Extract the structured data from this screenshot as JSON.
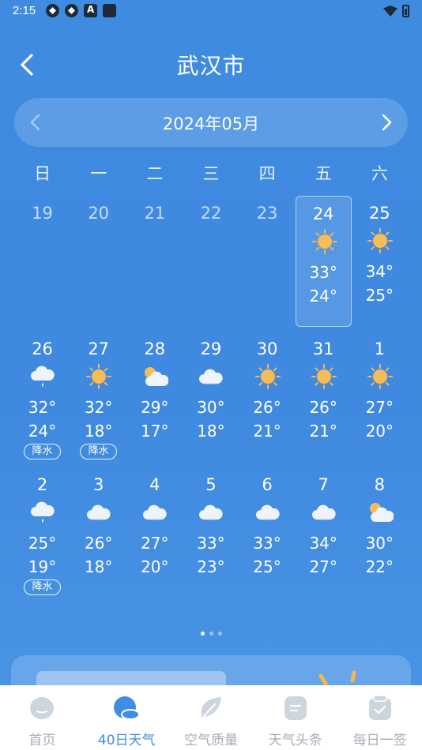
{
  "status_bar": {
    "time": "2:15"
  },
  "header": {
    "title": "武汉市"
  },
  "month_nav": {
    "label": "2024年05月"
  },
  "weekdays": [
    "日",
    "一",
    "二",
    "三",
    "四",
    "五",
    "六"
  ],
  "calendar": {
    "rows": [
      [
        {
          "day": "19",
          "past": true
        },
        {
          "day": "20",
          "past": true
        },
        {
          "day": "21",
          "past": true
        },
        {
          "day": "22",
          "past": true
        },
        {
          "day": "23",
          "past": true
        },
        {
          "day": "24",
          "icon": "sunny-icon",
          "high": "33°",
          "low": "24°",
          "selected": true
        },
        {
          "day": "25",
          "icon": "sunny-icon",
          "high": "34°",
          "low": "25°"
        }
      ],
      [
        {
          "day": "26",
          "icon": "rain-icon",
          "high": "32°",
          "low": "24°",
          "tag": "降水"
        },
        {
          "day": "27",
          "icon": "sunny-icon",
          "high": "32°",
          "low": "18°",
          "tag": "降水"
        },
        {
          "day": "28",
          "icon": "partly-cloudy-icon",
          "high": "29°",
          "low": "17°"
        },
        {
          "day": "29",
          "icon": "cloudy-icon",
          "high": "30°",
          "low": "18°"
        },
        {
          "day": "30",
          "icon": "sunny-icon",
          "high": "26°",
          "low": "21°"
        },
        {
          "day": "31",
          "icon": "sunny-icon",
          "high": "26°",
          "low": "21°"
        },
        {
          "day": "1",
          "icon": "sunny-icon",
          "high": "27°",
          "low": "20°"
        }
      ],
      [
        {
          "day": "2",
          "icon": "rain-icon",
          "high": "25°",
          "low": "19°",
          "tag": "降水"
        },
        {
          "day": "3",
          "icon": "cloudy-icon",
          "high": "26°",
          "low": "18°"
        },
        {
          "day": "4",
          "icon": "cloudy-icon",
          "high": "27°",
          "low": "20°"
        },
        {
          "day": "5",
          "icon": "cloudy-icon",
          "high": "33°",
          "low": "23°"
        },
        {
          "day": "6",
          "icon": "cloudy-icon",
          "high": "33°",
          "low": "25°"
        },
        {
          "day": "7",
          "icon": "cloudy-icon",
          "high": "34°",
          "low": "27°"
        },
        {
          "day": "8",
          "icon": "partly-cloudy-icon",
          "high": "30°",
          "low": "22°"
        }
      ]
    ]
  },
  "pager": {
    "count": 3,
    "active": 0
  },
  "bottom_nav": {
    "items": [
      {
        "label": "首页",
        "icon": "home-icon",
        "active": false
      },
      {
        "label": "40日天气",
        "icon": "weather-40day-icon",
        "active": true
      },
      {
        "label": "空气质量",
        "icon": "air-quality-icon",
        "active": false
      },
      {
        "label": "天气头条",
        "icon": "headlines-icon",
        "active": false
      },
      {
        "label": "每日一签",
        "icon": "daily-sign-icon",
        "active": false
      }
    ]
  },
  "colors": {
    "background": "#3f8be0",
    "accent": "#3e8ee6",
    "nav_inactive": "#a6adb8",
    "sun": "#f7b64a"
  }
}
